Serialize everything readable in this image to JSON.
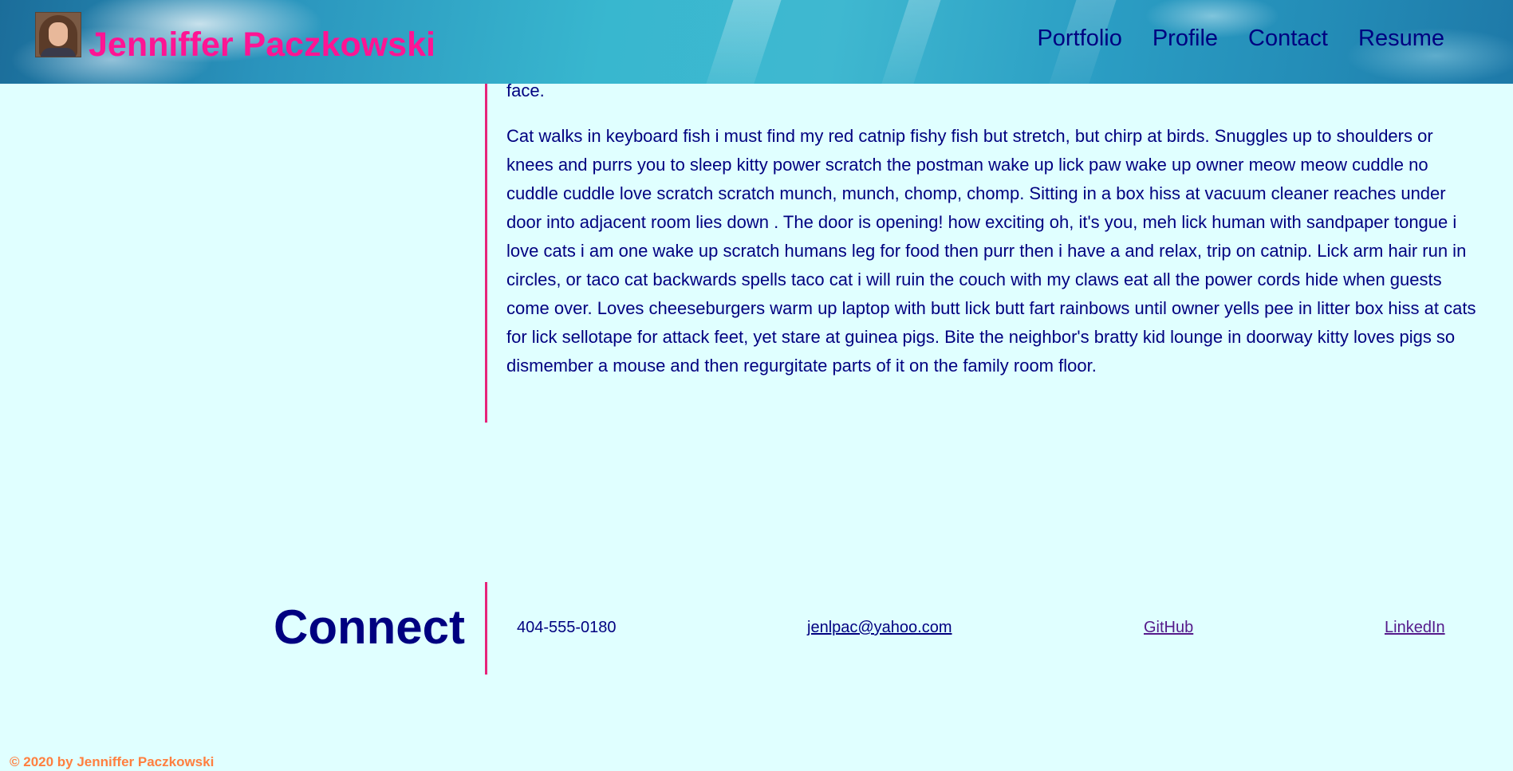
{
  "header": {
    "title": "Jenniffer Paczkowski",
    "avatar_alt": "Jenniffer Paczkowski profile photo",
    "nav": [
      {
        "label": "Portfolio"
      },
      {
        "label": "Profile"
      },
      {
        "label": "Contact"
      },
      {
        "label": "Resume"
      }
    ]
  },
  "main": {
    "paragraphs": [
      "master of hoomaan, not hoomaan master of i, oooh damn dat dog so catto munch salmono but lick butt and make a weird face.",
      "Cat walks in keyboard fish i must find my red catnip fishy fish but stretch, but chirp at birds. Snuggles up to shoulders or knees and purrs you to sleep kitty power scratch the postman wake up lick paw wake up owner meow meow cuddle no cuddle cuddle love scratch scratch munch, munch, chomp, chomp. Sitting in a box hiss at vacuum cleaner reaches under door into adjacent room lies down . The door is opening! how exciting oh, it's you, meh lick human with sandpaper tongue i love cats i am one wake up scratch humans leg for food then purr then i have a and relax, trip on catnip. Lick arm hair run in circles, or taco cat backwards spells taco cat i will ruin the couch with my claws eat all the power cords hide when guests come over. Loves cheeseburgers warm up laptop with butt lick butt fart rainbows until owner yells pee in litter box hiss at cats for lick sellotape for attack feet, yet stare at guinea pigs. Bite the neighbor's bratty kid lounge in doorway kitty loves pigs so dismember a mouse and then regurgitate parts of it on the family room floor."
    ]
  },
  "connect": {
    "title": "Connect",
    "phone": "404-555-0180",
    "email": "jenlpac@yahoo.com",
    "github": "GitHub",
    "linkedin": "LinkedIn"
  },
  "footer": {
    "copyright": "© 2020 by Jenniffer Paczkowski"
  },
  "colors": {
    "background": "#e0ffff",
    "title_pink": "#ff1493",
    "navy_text": "#000080",
    "accent_border": "#e6247a",
    "visited_link": "#551a8b",
    "copyright_orange": "#ff7f3f"
  }
}
